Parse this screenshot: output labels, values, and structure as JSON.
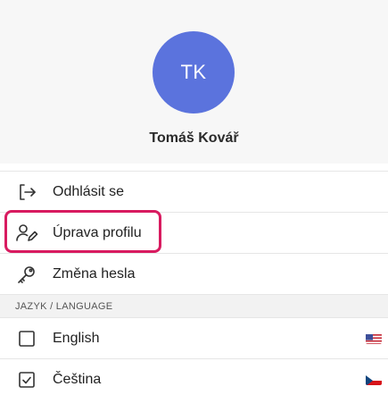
{
  "profile": {
    "initials": "TK",
    "name": "Tomáš Kovář",
    "avatar_color": "#5b73dd"
  },
  "menu": {
    "logout": {
      "label": "Odhlásit se",
      "icon": "logout-icon"
    },
    "edit_profile": {
      "label": "Úprava profilu",
      "icon": "user-edit-icon",
      "highlighted": true
    },
    "change_password": {
      "label": "Změna hesla",
      "icon": "key-icon"
    }
  },
  "language": {
    "section_title": "JAZYK / LANGUAGE",
    "options": [
      {
        "label": "English",
        "checked": false,
        "flag": "us-flag-icon"
      },
      {
        "label": "Čeština",
        "checked": true,
        "flag": "cz-flag-icon"
      }
    ]
  },
  "colors": {
    "highlight": "#d81b60",
    "header_bg": "#f7f7f7"
  }
}
